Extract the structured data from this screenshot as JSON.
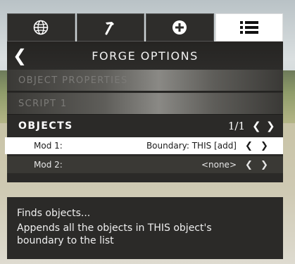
{
  "tabs": [
    {
      "icon": "globe-icon",
      "active": false
    },
    {
      "icon": "hammer-icon",
      "active": false
    },
    {
      "icon": "plus-circle-icon",
      "active": false
    },
    {
      "icon": "list-icon",
      "active": true
    }
  ],
  "header": {
    "back_glyph": "❮",
    "title": "FORGE OPTIONS"
  },
  "sections": [
    {
      "label": "OBJECT PROPERTIES"
    },
    {
      "label": "SCRIPT 1"
    }
  ],
  "objects": {
    "label": "OBJECTS",
    "counter": "1/1",
    "prev_glyph": "❮",
    "next_glyph": "❯",
    "mods": [
      {
        "label": "Mod 1:",
        "value": "Boundary: THIS [add]",
        "prev": "❮",
        "next": "❯"
      },
      {
        "label": "Mod 2:",
        "value": "<none>",
        "prev": "❮",
        "next": "❯"
      }
    ]
  },
  "description": {
    "title": "Finds objects...",
    "body": "Appends all the objects in THIS object's boundary to the list"
  }
}
